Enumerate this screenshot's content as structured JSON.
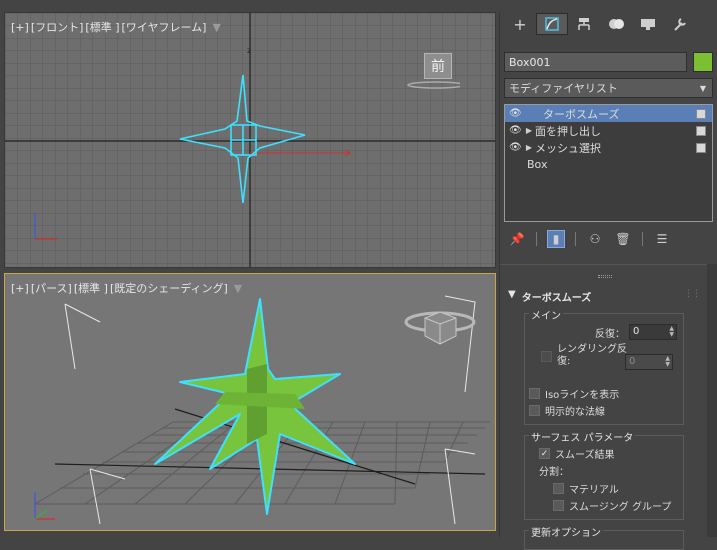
{
  "viewport_front": {
    "label_parts": [
      "[+]",
      "[フロント]",
      "[標準 ]",
      "[ワイヤフレーム]"
    ],
    "navcube_text": "前"
  },
  "viewport_persp": {
    "label_parts": [
      "[+]",
      "[パース]",
      "[標準 ]",
      "[既定のシェーディング]"
    ]
  },
  "panel": {
    "tabs": [
      {
        "icon": "create-icon",
        "glyph": "+"
      },
      {
        "icon": "modify-icon",
        "glyph": "⌒"
      },
      {
        "icon": "hierarchy-icon",
        "glyph": "⊟"
      },
      {
        "icon": "motion-icon",
        "glyph": "●"
      },
      {
        "icon": "display-icon",
        "glyph": "▭"
      },
      {
        "icon": "utilities-icon",
        "glyph": "✎"
      }
    ],
    "object_name": "Box001",
    "object_color": "#7cbf33",
    "modifier_list_label": "モディファイヤリスト",
    "stack": [
      {
        "label": "ターボスムーズ",
        "selected": true
      },
      {
        "label": "面を押し出し",
        "selected": false
      },
      {
        "label": "メッシュ選択",
        "selected": false
      }
    ],
    "stack_base": "Box"
  },
  "rollout": {
    "title": "ターボスムーズ",
    "main_group": "メイン",
    "iterations_label": "反復：",
    "iterations_value": "0",
    "render_iter_label_1": "レンダリング反",
    "render_iter_label_2": "復:",
    "render_iter_value": "0",
    "isoline_label": "Isoラインを表示",
    "explicit_normals_label": "明示的な法線",
    "surface_group": "サーフェス パラメータ",
    "smooth_result_label": "スムーズ結果",
    "separate_label": "分割：",
    "material_label": "マテリアル",
    "smoothing_groups_label": "スムージング グループ",
    "update_group": "更新オプション"
  }
}
